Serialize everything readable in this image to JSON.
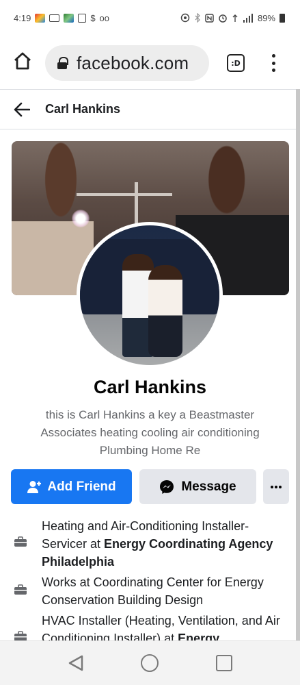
{
  "status_bar": {
    "time": "4:19",
    "dollar": "$",
    "voicemail": "oo",
    "battery": "89%"
  },
  "browser": {
    "url": "facebook.com",
    "tab_switcher_label": ":D"
  },
  "header": {
    "title": "Carl Hankins"
  },
  "profile": {
    "name": "Carl Hankins",
    "bio": "this is Carl Hankins a key a Beastmaster Associates heating cooling air conditioning Plumbing Home Re"
  },
  "actions": {
    "add_friend": "Add Friend",
    "message": "Message"
  },
  "details": [
    {
      "prefix": "Heating and Air-Conditioning Installer-Servicer at ",
      "bold": "Energy Coordinating Agency Philadelphia"
    },
    {
      "prefix": "Works at Coordinating Center for Energy Conservation Building Design",
      "bold": ""
    },
    {
      "prefix": "HVAC Installer (Heating, Ventilation, and Air Conditioning Installer) at ",
      "bold": "Energy"
    }
  ],
  "colors": {
    "primary_button": "#1877f2",
    "secondary_button": "#e4e6eb",
    "bio_text": "#65676b"
  },
  "icons": {
    "home": "home-icon",
    "lock": "lock-icon",
    "tab_switcher": "tab-switcher-icon",
    "menu": "more-vertical-icon",
    "back": "back-arrow-icon",
    "add_friend": "add-person-icon",
    "message": "messenger-icon",
    "more": "more-horizontal-icon",
    "work": "briefcase-icon"
  }
}
